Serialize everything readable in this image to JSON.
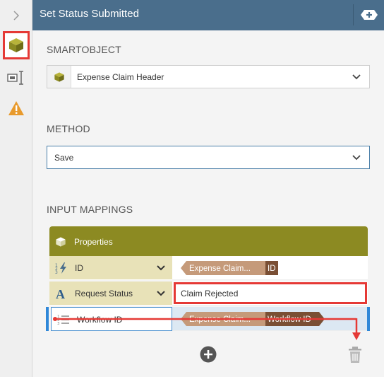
{
  "rail": {
    "items": [
      {
        "icon": "expand-chevron-icon"
      },
      {
        "icon": "smartobject-cube-icon",
        "selected": true
      },
      {
        "icon": "mapping-icon"
      },
      {
        "icon": "warning-icon"
      }
    ]
  },
  "header": {
    "title": "Set Status Submitted",
    "add_icon": "add-tab-icon",
    "color": "#4a6e8c"
  },
  "smartobject": {
    "label": "SMARTOBJECT",
    "value": "Expense Claim Header",
    "icon": "smartobject-cube-icon"
  },
  "method": {
    "label": "METHOD",
    "value": "Save"
  },
  "input_mappings": {
    "label": "INPUT MAPPINGS",
    "header_title": "Properties",
    "header_color": "#8c8a22",
    "rows": [
      {
        "label": "ID",
        "icon": "autonumber-icon",
        "token_source": "Expense Claim...",
        "token_field": "ID"
      },
      {
        "label": "Request Status",
        "icon": "text-type-icon",
        "value": "Claim Rejected"
      },
      {
        "label": "Workflow ID",
        "icon": "number-list-icon",
        "token_source": "Expense Claim...",
        "token_field": "Workflow ID"
      }
    ]
  },
  "actions": {
    "add_icon": "add-circle-icon",
    "delete_icon": "trash-icon"
  },
  "colors": {
    "highlight": "#e53935",
    "selection": "#2f87d8",
    "token_light": "#c59a7a",
    "token_dark": "#7a4f34"
  }
}
